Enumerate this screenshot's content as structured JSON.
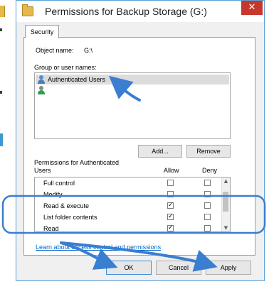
{
  "window": {
    "title": "Permissions for Backup Storage (G:)",
    "close_glyph": "✕"
  },
  "tab": {
    "label": "Security"
  },
  "object": {
    "label": "Object name:",
    "value": "G:\\"
  },
  "users": {
    "label": "Group or user names:",
    "items": [
      {
        "name": "Authenticated Users",
        "icon": "users-group-icon",
        "selected": true
      },
      {
        "name": "",
        "icon": "user-icon",
        "selected": false
      }
    ],
    "add_label": "Add...",
    "remove_label": "Remove"
  },
  "permissions": {
    "label_line1": "Permissions for Authenticated",
    "label_line2": "Users",
    "allow_header": "Allow",
    "deny_header": "Deny",
    "rows": [
      {
        "name": "Full control",
        "allow": false,
        "deny": false
      },
      {
        "name": "Modify",
        "allow": false,
        "deny": false
      },
      {
        "name": "Read & execute",
        "allow": true,
        "deny": false
      },
      {
        "name": "List folder contents",
        "allow": true,
        "deny": false
      },
      {
        "name": "Read",
        "allow": true,
        "deny": false
      }
    ],
    "check_glyph": "✓"
  },
  "link": {
    "text": "Learn about access control and permissions"
  },
  "buttons": {
    "ok": "OK",
    "cancel": "Cancel",
    "apply": "Apply"
  },
  "colors": {
    "annotation_blue": "#3a7ed0",
    "close_red": "#c7372b",
    "link_blue": "#0066cc"
  }
}
